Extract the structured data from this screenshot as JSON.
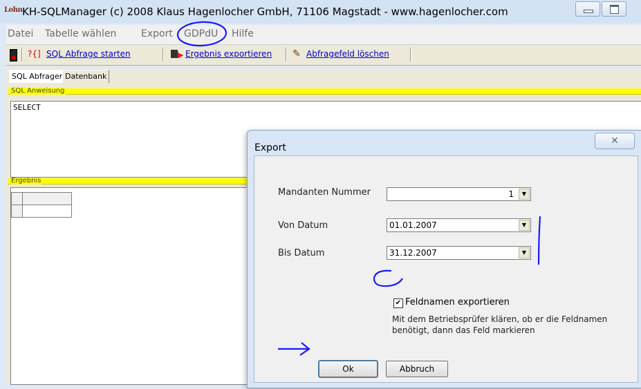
{
  "window": {
    "app_icon_text": "Lohn",
    "title": "KH-SQLManager (c) 2008 Klaus Hagenlocher GmbH, 71106 Magstadt - www.hagenlocher.com"
  },
  "menu": {
    "items": [
      "Datei",
      "Tabelle wählen",
      "Export",
      "GDPdU",
      "Hilfe"
    ]
  },
  "toolbar": {
    "run_query_icon": "?{]",
    "run_query": "SQL Abfrage starten",
    "export_result": "Ergebnis exportieren",
    "clear_query": "Abfragefeld löschen"
  },
  "tabs": [
    "SQL Abfragen",
    "Datenbank"
  ],
  "sql_panel": {
    "label": "SQL Anweisung",
    "text": "SELECT"
  },
  "result_panel": {
    "label": "Ergebnis"
  },
  "dialog": {
    "title": "Export",
    "mandant_label": "Mandanten Nummer",
    "mandant_value": "1",
    "von_label": "Von Datum",
    "von_value": "01.01.2007",
    "bis_label": "Bis Datum",
    "bis_value": "31.12.2007",
    "checkbox_label": "Feldnamen exportieren",
    "checkbox_checked": true,
    "hint_line1": "Mit dem Betriebsprüfer klären, ob er die Feldnamen",
    "hint_line2": "benötigt, dann das Feld markieren",
    "ok_label": "Ok",
    "cancel_label": "Abbruch"
  },
  "colors": {
    "annotation": "#1a1aff",
    "yellow_bar": "#ffff00",
    "link": "#0000cc"
  }
}
